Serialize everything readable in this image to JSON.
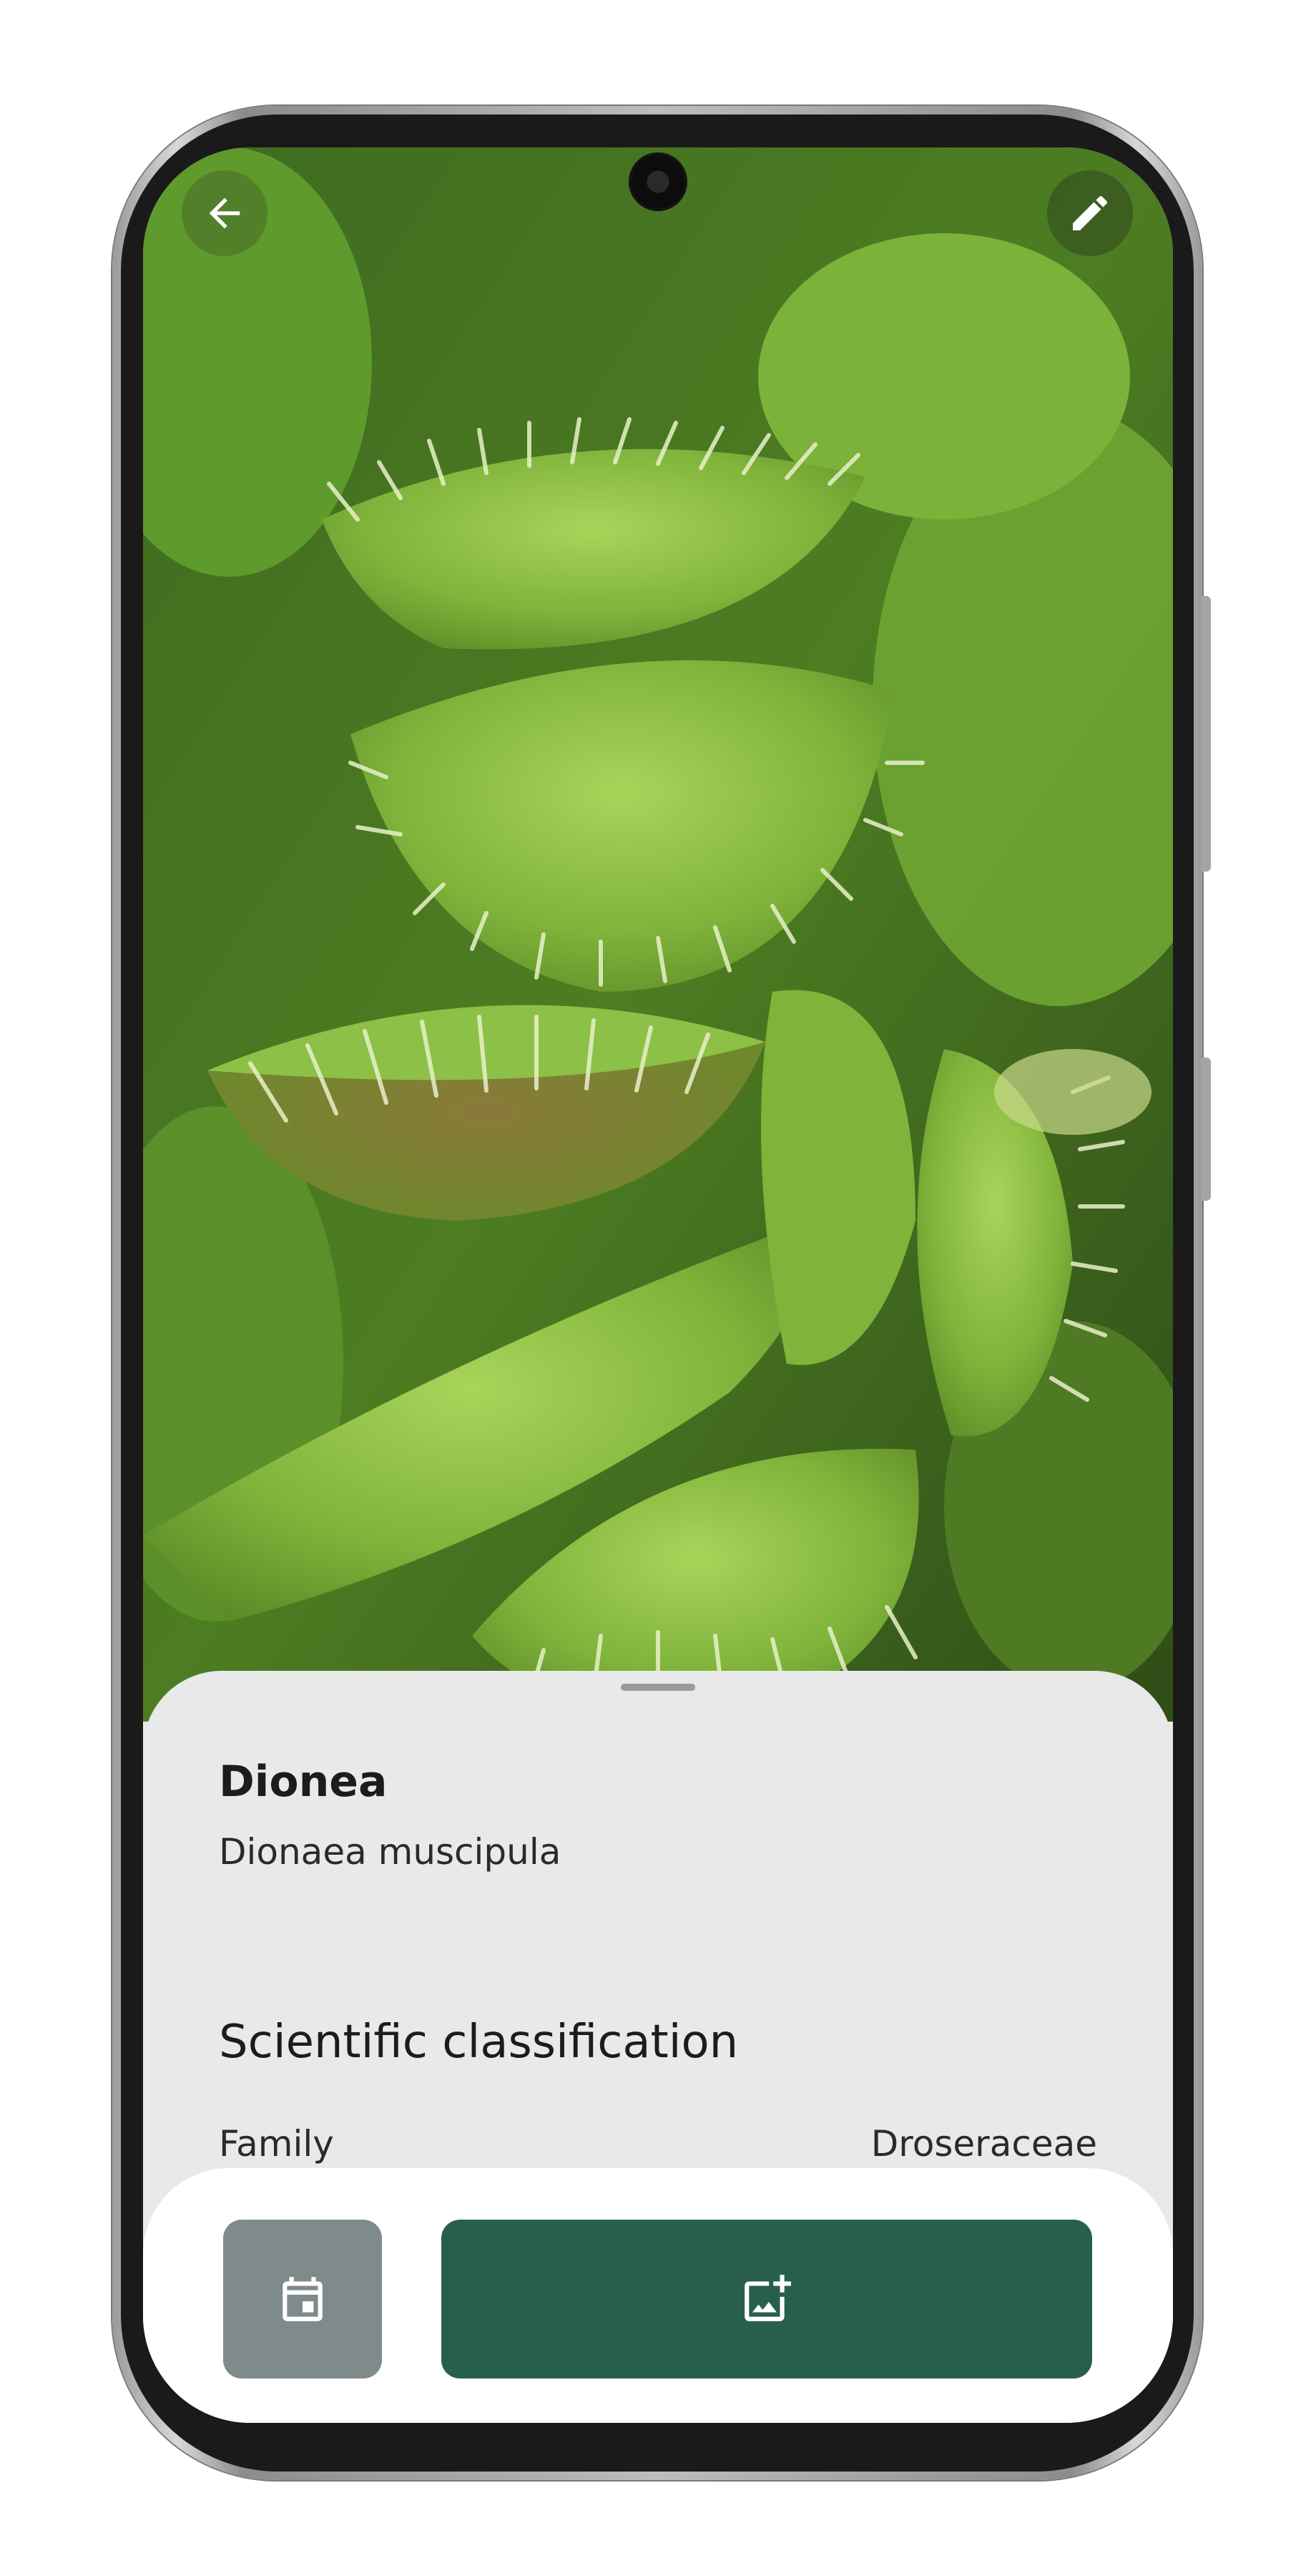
{
  "plant": {
    "common_name": "Dionea",
    "scientific_name": "Dionaea muscipula"
  },
  "classification": {
    "title": "Scientific classification",
    "rows": [
      {
        "label": "Family",
        "value": "Droseraceae"
      }
    ]
  },
  "icons": {
    "back": "arrow-back-icon",
    "edit": "pencil-icon",
    "calendar": "calendar-icon",
    "add_photo": "add-photo-icon"
  },
  "colors": {
    "primary_button": "#285f4b",
    "secondary_button": "#7f8b8a",
    "sheet_background": "#e9e9e9"
  }
}
